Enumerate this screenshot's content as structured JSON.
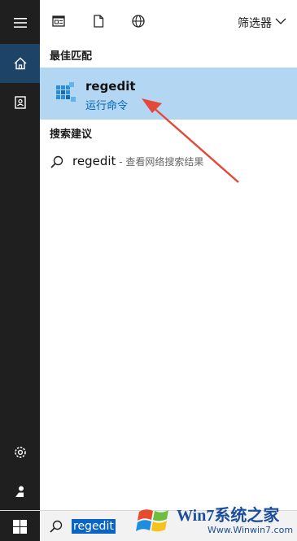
{
  "toolbar": {
    "filter_label": "筛选器",
    "icons": [
      "news-icon",
      "document-icon",
      "globe-icon",
      "chevron-down-icon"
    ]
  },
  "sidebar": {
    "icons": [
      "hamburger-menu-icon",
      "home-icon",
      "notebook-icon",
      "settings-gear-icon",
      "user-icon"
    ]
  },
  "best_match": {
    "header": "最佳匹配",
    "title": "regedit",
    "subtitle": "运行命令",
    "icon": "registry-editor-icon"
  },
  "suggestions": {
    "header": "搜索建议",
    "items": [
      {
        "text": "regedit",
        "hint": " - 查看网络搜索结果"
      }
    ]
  },
  "taskbar": {
    "search_value": "regedit",
    "icons": [
      "windows-start-icon",
      "search-icon"
    ]
  },
  "watermark": {
    "title": "Win7系统之家",
    "url": "Www.Winwin7.com"
  },
  "colors": {
    "sidebar_bg": "#1f1f1f",
    "selected_item_bg": "#b3d7f3",
    "accent_blue": "#0063b1",
    "annotation_arrow": "#e5483a"
  }
}
